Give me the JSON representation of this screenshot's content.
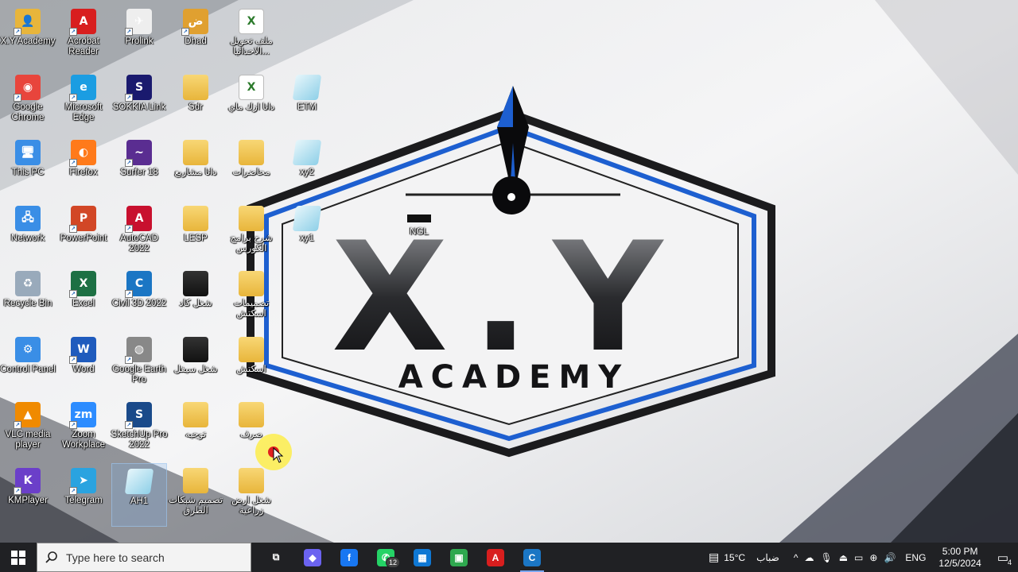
{
  "desktop": {
    "icons": [
      {
        "label": "X.Y Academy",
        "icon": "user-folder-icon",
        "color": "#e8b53b"
      },
      {
        "label": "Acrobat Reader",
        "icon": "acrobat-icon",
        "color": "#d81e1e"
      },
      {
        "label": "Prolink",
        "icon": "prolink-icon",
        "color": "#eeeeee"
      },
      {
        "label": "Dhad",
        "icon": "dhad-icon",
        "color": "#e0a030"
      },
      {
        "label": "ملف تحويل الاحداثيا...",
        "icon": "excel-file-icon",
        "color": "#ffffff"
      },
      {
        "label": "Google Chrome",
        "icon": "chrome-icon",
        "color": "#e8453c"
      },
      {
        "label": "Microsoft Edge",
        "icon": "edge-icon",
        "color": "#1b9de2"
      },
      {
        "label": "SOKKIA Link",
        "icon": "sokkia-icon",
        "color": "#1a1a6e"
      },
      {
        "label": "Sdr",
        "icon": "folder-icon",
        "color": "#e8b53b"
      },
      {
        "label": "داتا ازك ماي",
        "icon": "excel-file-icon",
        "color": "#ffffff"
      },
      {
        "label": "ETM",
        "icon": "file-icon",
        "color": "#8fd0e8"
      },
      {
        "label": "This PC",
        "icon": "computer-icon",
        "color": "#3a8ee6"
      },
      {
        "label": "Firefox",
        "icon": "firefox-icon",
        "color": "#ff7a1a"
      },
      {
        "label": "Surfer 18",
        "icon": "surfer-icon",
        "color": "#5a2d91"
      },
      {
        "label": "داتا مشاريع",
        "icon": "folder-icon",
        "color": "#e8b53b"
      },
      {
        "label": "محاضرات",
        "icon": "folder-icon",
        "color": "#c9a96a"
      },
      {
        "label": "xy2",
        "icon": "file-icon",
        "color": "#8fd0e8"
      },
      {
        "label": "Network",
        "icon": "network-icon",
        "color": "#3a8ee6"
      },
      {
        "label": "PowerPoint",
        "icon": "powerpoint-icon",
        "color": "#d24726"
      },
      {
        "label": "AutoCAD 2022",
        "icon": "autocad-icon",
        "color": "#c8102e"
      },
      {
        "label": "LESP",
        "icon": "folder-icon",
        "color": "#e8b53b"
      },
      {
        "label": "شرح برامج الكورس",
        "icon": "folder-icon",
        "color": "#e8b53b"
      },
      {
        "label": "xy1",
        "icon": "file-icon",
        "color": "#8fd0e8"
      },
      {
        "label": "NGL",
        "icon": "ngl-icon",
        "color": "#111111"
      },
      {
        "label": "Recycle Bin",
        "icon": "recycle-bin-icon",
        "color": "#9ab"
      },
      {
        "label": "Excel",
        "icon": "excel-icon",
        "color": "#1d7044"
      },
      {
        "label": "Civil 3D 2022",
        "icon": "civil3d-icon",
        "color": "#1b76c4"
      },
      {
        "label": "شغل كاد",
        "icon": "folder-icon",
        "color": "#222"
      },
      {
        "label": "تصميمات اسكتش",
        "icon": "folder-icon",
        "color": "#e8b53b"
      },
      {
        "label": "Control Panel",
        "icon": "control-panel-icon",
        "color": "#3a8ee6"
      },
      {
        "label": "Word",
        "icon": "word-icon",
        "color": "#1f5bbd"
      },
      {
        "label": "Google Earth Pro",
        "icon": "google-earth-icon",
        "color": "#888"
      },
      {
        "label": "شغل سيفل",
        "icon": "folder-icon",
        "color": "#222"
      },
      {
        "label": "اسكتش",
        "icon": "folder-icon",
        "color": "#e8b53b"
      },
      {
        "label": "VLC media player",
        "icon": "vlc-icon",
        "color": "#f08a00"
      },
      {
        "label": "Zoom Workplace",
        "icon": "zoom-icon",
        "color": "#2d8cff"
      },
      {
        "label": "SketchUp Pro 2022",
        "icon": "sketchup-icon",
        "color": "#1a4a8a"
      },
      {
        "label": "توجيه",
        "icon": "folder-icon",
        "color": "#e8b53b"
      },
      {
        "label": "صرف",
        "icon": "folder-icon",
        "color": "#e8b53b"
      },
      {
        "label": "KMPlayer",
        "icon": "kmplayer-icon",
        "color": "#6b3fc9"
      },
      {
        "label": "Telegram",
        "icon": "telegram-icon",
        "color": "#2aa3e0"
      },
      {
        "label": "AH1",
        "icon": "file-icon",
        "color": "#8fd0e8"
      },
      {
        "label": "تصميم شبكات الطرق",
        "icon": "folder-icon",
        "color": "#e8b53b"
      },
      {
        "label": "شغل ارض زراعية",
        "icon": "folder-icon",
        "color": "#e8b53b"
      }
    ]
  },
  "wallpaper": {
    "line1": "X.Y",
    "line2": "ACADEMY",
    "accent": "#1d5fd0"
  },
  "taskbar": {
    "search_placeholder": "Type here to search",
    "apps": [
      {
        "name": "task-view",
        "glyph": "⧉",
        "color": "#202124",
        "badge": ""
      },
      {
        "name": "copilot",
        "glyph": "◆",
        "color": "#6b63f0",
        "badge": ""
      },
      {
        "name": "facebook",
        "glyph": "f",
        "color": "#1877f2",
        "badge": ""
      },
      {
        "name": "whatsapp",
        "glyph": "✆",
        "color": "#25d366",
        "badge": "12"
      },
      {
        "name": "microsoft-store",
        "glyph": "▦",
        "color": "#0f78d4",
        "badge": ""
      },
      {
        "name": "camtasia",
        "glyph": "▣",
        "color": "#2fa84f",
        "badge": ""
      },
      {
        "name": "acrobat",
        "glyph": "A",
        "color": "#d81e1e",
        "badge": ""
      },
      {
        "name": "civil3d",
        "glyph": "C",
        "color": "#1b76c4",
        "badge": ""
      }
    ],
    "weather": {
      "temp": "15°C",
      "desc": "ضباب"
    },
    "language": "ENG",
    "time": "5:00 PM",
    "date": "12/5/2024",
    "notification_count": "4"
  }
}
